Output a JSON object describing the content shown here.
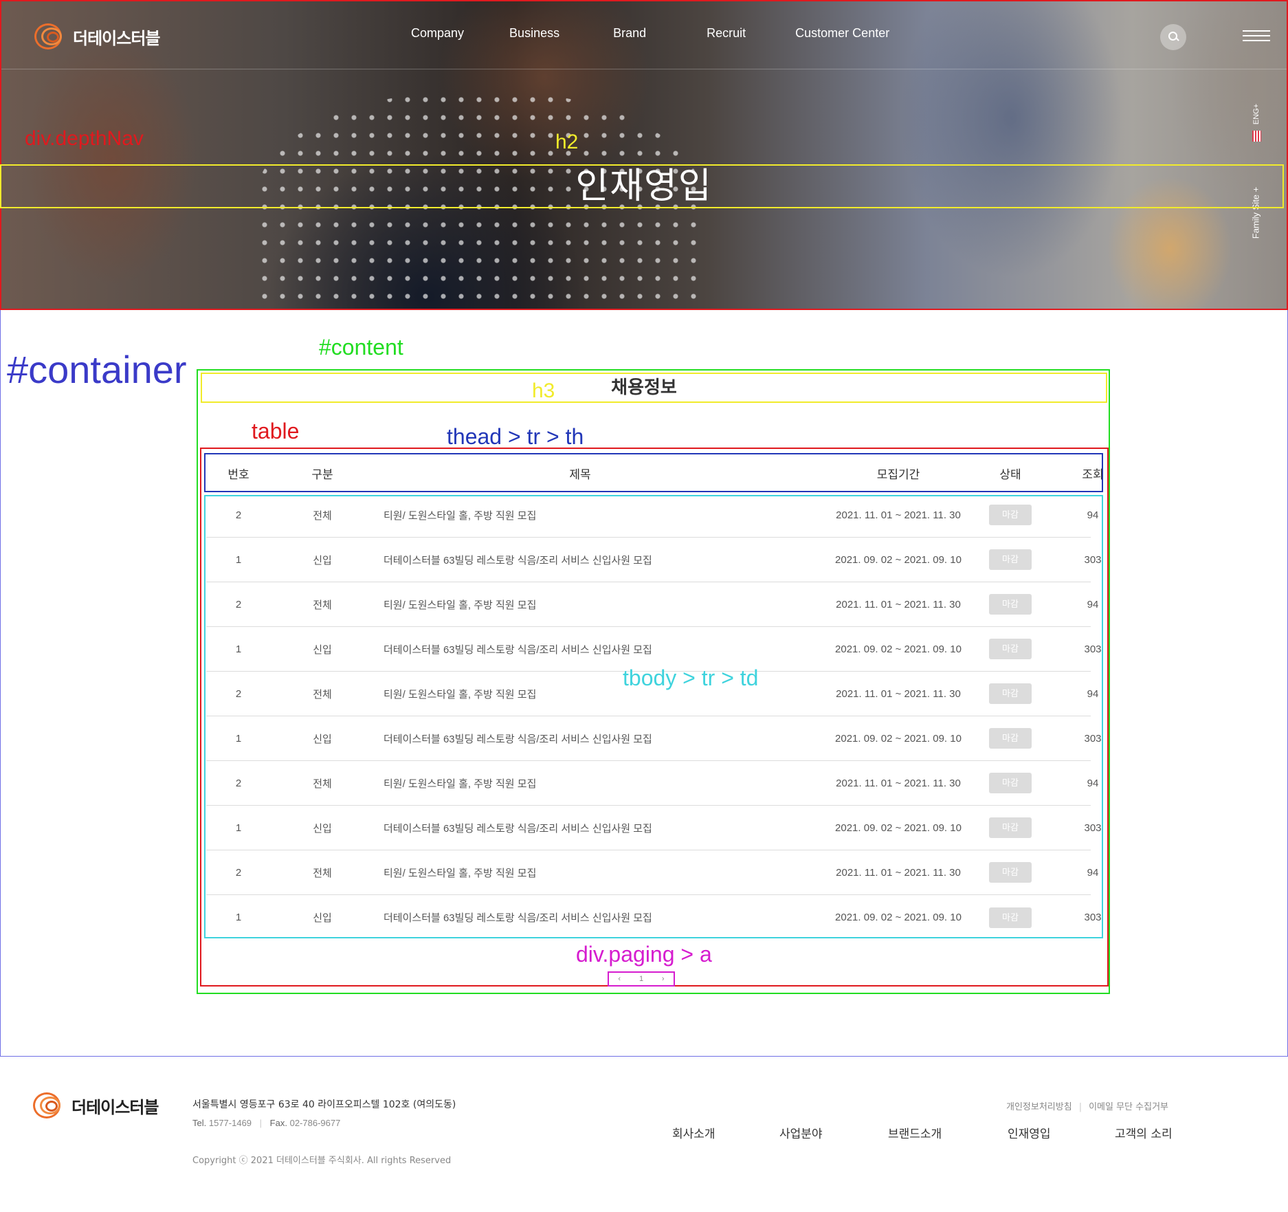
{
  "brand": {
    "name": "더테이스터블"
  },
  "nav": {
    "items": [
      "Company",
      "Business",
      "Brand",
      "Recruit",
      "Customer Center"
    ]
  },
  "side": {
    "eng": "ENG+",
    "family": "Family Site +"
  },
  "page_title": "인재영입",
  "section_title": "채용정보",
  "annotations": {
    "depthnav": "div.depthNav",
    "h2": "h2",
    "container": "#container",
    "content": "#content",
    "h3": "h3",
    "table": "table",
    "thead": "thead > tr > th",
    "tbody": "tbody > tr > td",
    "paging": "div.paging > a"
  },
  "table": {
    "headers": [
      "번호",
      "구분",
      "제목",
      "모집기간",
      "상태",
      "조회"
    ],
    "rows": [
      {
        "num": "2",
        "cat": "전체",
        "title": "티원/ 도원스타일 홀, 주방 직원 모집",
        "period": "2021. 11. 01 ~ 2021. 11. 30",
        "status": "마감",
        "views": "94"
      },
      {
        "num": "1",
        "cat": "신입",
        "title": "더테이스터블 63빌딩 레스토랑 식음/조리 서비스 신입사원 모집",
        "period": "2021. 09. 02 ~ 2021. 09. 10",
        "status": "마감",
        "views": "303"
      },
      {
        "num": "2",
        "cat": "전체",
        "title": "티원/ 도원스타일 홀, 주방 직원 모집",
        "period": "2021. 11. 01 ~ 2021. 11. 30",
        "status": "마감",
        "views": "94"
      },
      {
        "num": "1",
        "cat": "신입",
        "title": "더테이스터블 63빌딩 레스토랑 식음/조리 서비스 신입사원 모집",
        "period": "2021. 09. 02 ~ 2021. 09. 10",
        "status": "마감",
        "views": "303"
      },
      {
        "num": "2",
        "cat": "전체",
        "title": "티원/ 도원스타일 홀, 주방 직원 모집",
        "period": "2021. 11. 01 ~ 2021. 11. 30",
        "status": "마감",
        "views": "94"
      },
      {
        "num": "1",
        "cat": "신입",
        "title": "더테이스터블 63빌딩 레스토랑 식음/조리 서비스 신입사원 모집",
        "period": "2021. 09. 02 ~ 2021. 09. 10",
        "status": "마감",
        "views": "303"
      },
      {
        "num": "2",
        "cat": "전체",
        "title": "티원/ 도원스타일 홀, 주방 직원 모집",
        "period": "2021. 11. 01 ~ 2021. 11. 30",
        "status": "마감",
        "views": "94"
      },
      {
        "num": "1",
        "cat": "신입",
        "title": "더테이스터블 63빌딩 레스토랑 식음/조리 서비스 신입사원 모집",
        "period": "2021. 09. 02 ~ 2021. 09. 10",
        "status": "마감",
        "views": "303"
      },
      {
        "num": "2",
        "cat": "전체",
        "title": "티원/ 도원스타일 홀, 주방 직원 모집",
        "period": "2021. 11. 01 ~ 2021. 11. 30",
        "status": "마감",
        "views": "94"
      },
      {
        "num": "1",
        "cat": "신입",
        "title": "더테이스터블 63빌딩 레스토랑 식음/조리 서비스 신입사원 모집",
        "period": "2021. 09. 02 ~ 2021. 09. 10",
        "status": "마감",
        "views": "303"
      }
    ]
  },
  "paging": {
    "prev": "‹",
    "current": "1",
    "next": "›"
  },
  "footer": {
    "address": "서울특별시 영등포구 63로 40 라이프오피스텔 102호 (여의도동)",
    "tel_label": "Tel.",
    "tel": "1577-1469",
    "fax_label": "Fax.",
    "fax": "02-786-9677",
    "copyright": "Copyright ⓒ 2021 더테이스터블 주식회사. All rights Reserved",
    "util": [
      "개인정보처리방침",
      "이메일 무단 수집거부"
    ],
    "nav": [
      "회사소개",
      "사업분야",
      "브랜드소개",
      "인재영입",
      "고객의 소리"
    ]
  },
  "colors": {
    "accent": "#ec6e2b",
    "annotation_red": "#e0191e",
    "annotation_yellow": "#f1eb2b",
    "annotation_green": "#22dd22",
    "annotation_blue": "#2237b8",
    "annotation_cyan": "#3fd3dd",
    "annotation_magenta": "#d61ccf",
    "annotation_purple": "#3a3ac8",
    "badge_bg": "#dcdcdc"
  },
  "icons": [
    "logo-icon",
    "search-icon",
    "menu-icon",
    "flag-icon"
  ]
}
